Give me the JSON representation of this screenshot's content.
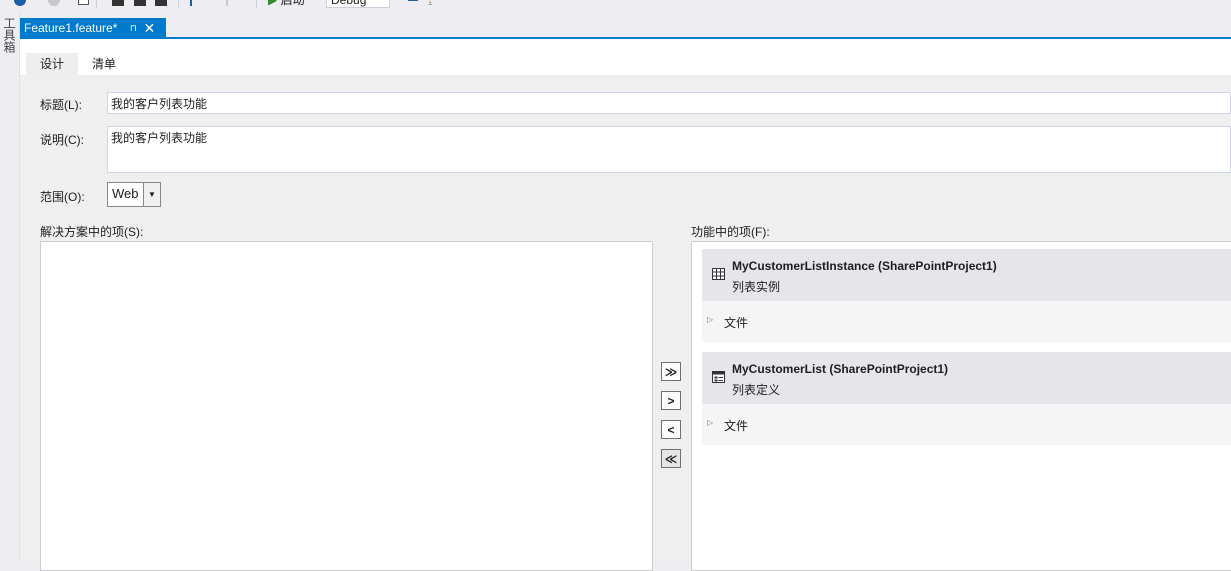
{
  "toolbar": {
    "start_label": "启动",
    "config_value": "Debug"
  },
  "toolbox": {
    "label": "工具箱"
  },
  "document_tab": {
    "title": "Feature1.feature*",
    "pin_glyph": "⊓",
    "close_glyph": "✕"
  },
  "inner_tabs": [
    {
      "label": "设计",
      "active": true
    },
    {
      "label": "清单",
      "active": false
    }
  ],
  "form": {
    "title_label": "标题(L):",
    "title_value": "我的客户列表功能",
    "description_label": "说明(C):",
    "description_value": "我的客户列表功能",
    "scope_label": "范围(O):",
    "scope_value": "Web"
  },
  "solution_items": {
    "label": "解决方案中的项(S):",
    "items": []
  },
  "feature_items": {
    "label": "功能中的项(F):",
    "items": [
      {
        "title": "MyCustomerListInstance (SharePointProject1)",
        "subtitle": "列表实例",
        "files_label": "文件",
        "icon": "table-icon"
      },
      {
        "title": "MyCustomerList (SharePointProject1)",
        "subtitle": "列表定义",
        "files_label": "文件",
        "icon": "list-definition-icon"
      }
    ]
  },
  "move_buttons": [
    {
      "name": "add-all-button",
      "glyph": "≫"
    },
    {
      "name": "add-button",
      "glyph": ">"
    },
    {
      "name": "remove-button",
      "glyph": "<"
    },
    {
      "name": "remove-all-button",
      "glyph": "≪"
    }
  ],
  "colors": {
    "accent": "#007acc",
    "background": "#eeeef2",
    "item_header": "#e6e6ea"
  }
}
